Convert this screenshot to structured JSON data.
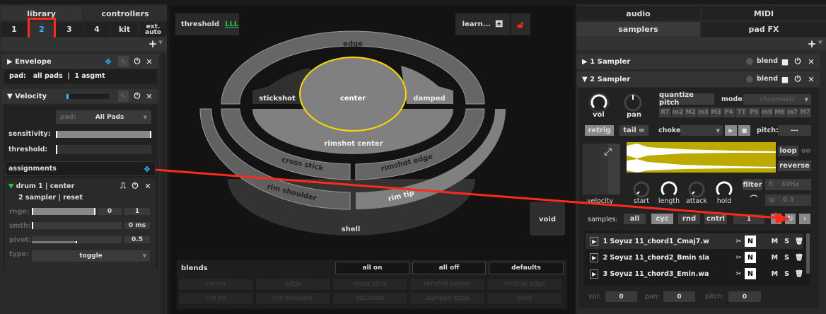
{
  "left": {
    "tabs": [
      "library",
      "controllers"
    ],
    "slots": [
      "1",
      "2",
      "3",
      "4",
      "kit",
      "ext.\nauto"
    ],
    "selected_slot": "2",
    "add": "+",
    "envelope": {
      "title": "Envelope",
      "pad_info": "pad:   all pads  |  1 asgmt"
    },
    "velocity": {
      "title": "Velocity",
      "meter_level": 0.05,
      "pad_label": "pad:",
      "pad_value": "All Pads",
      "sensitivity_label": "sensitivity:",
      "threshold_label": "threshold:",
      "assignments_label": "assignments",
      "assignment": {
        "title": "drum 1 | center",
        "subtitle": "2 sampler | reset",
        "range_label": "rnge:",
        "range_min": "0",
        "range_max": "1",
        "smooth_label": "smth:",
        "smooth_value": "0 ms",
        "pivot_label": "pivot:",
        "pivot_value": "0.5",
        "pivot_level": 0.5,
        "type_label": "type:",
        "type_value": "toggle"
      }
    }
  },
  "center": {
    "threshold_label": "threshold",
    "learn_label": "learn...",
    "zones": {
      "edge": "edge",
      "center": "center",
      "stickshot": "stickshot",
      "damped": "damped",
      "rimshot_center": "rimshot center",
      "cross_stick": "cross stick",
      "rimshot_edge": "rimshot edge",
      "rim_shoulder": "rim shoulder",
      "rim_tip": "rim tip",
      "shell": "shell",
      "void": "void"
    },
    "selected_zone": "center",
    "blends": {
      "title": "blends",
      "all_on": "all on",
      "all_off": "all off",
      "defaults": "defaults",
      "items": [
        "center",
        "edge",
        "cross stick",
        "rimshot center",
        "rimshot edge",
        "rim tip",
        "rim shoulder",
        "stickshot",
        "damped edge",
        "shell"
      ]
    }
  },
  "right": {
    "tabs_top": [
      "audio",
      "MIDI"
    ],
    "tabs_bottom": [
      "samplers",
      "pad FX"
    ],
    "add": "+",
    "sampler1": {
      "title": "1 Sampler",
      "blend": "blend"
    },
    "sampler2": {
      "title": "2 Sampler",
      "blend": "blend",
      "vol": "vol",
      "pan": "pan",
      "quantize": "quantize pitch",
      "mode_label": "mode:",
      "mode_value": "chromatic",
      "intervals": [
        "RT",
        "m2",
        "M2",
        "m3",
        "M3",
        "P4",
        "TT",
        "P5",
        "m6",
        "M6",
        "m7",
        "M7"
      ],
      "retrig": "retrig",
      "tail": "tail",
      "choke_label": "choke:",
      "pitch_label": "pitch:",
      "pitch_value": "---",
      "loop": "loop",
      "reverse": "reverse",
      "velocity": "velocity",
      "knobs": [
        "start",
        "length",
        "attack",
        "hold"
      ],
      "filter": "filter",
      "freq_label": "f:",
      "freq_value": "30Hz",
      "q_label": "q:",
      "q_value": "0.1",
      "samples_label": "samples:",
      "modes": [
        "all",
        "cyc",
        "rnd",
        "cntrl"
      ],
      "selected_mode": "cyc",
      "sample_index": "1",
      "samples": [
        "1 Soyuz 11_chord1_Cmaj7.w",
        "2 Soyuz 11_chord2_Bmin sla",
        "3 Soyuz 11_chord3_Emin.wa"
      ],
      "sample_flags": {
        "n": "N",
        "m": "M",
        "s": "S"
      },
      "vol_label": "vol:",
      "vol_value": "0",
      "pan_label": "pan:",
      "pan_value": "0",
      "pitch2_label": "pitch:",
      "pitch2_value": "0"
    },
    "waveform_color": "#bcaa00"
  },
  "colors": {
    "accent_blue": "#3ab0ff",
    "highlight_red": "#ff2a1a",
    "zone_select": "#ffd800",
    "meter_green": "#22cc44"
  }
}
